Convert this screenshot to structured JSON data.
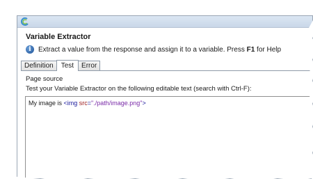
{
  "dialog": {
    "title": "Variable Extractor",
    "description_prefix": "Extract a value from the response and assign it to a variable. Press ",
    "description_key": "F1",
    "description_suffix": " for Help"
  },
  "tabs": [
    {
      "label": "Definition",
      "active": false
    },
    {
      "label": "Test",
      "active": true
    },
    {
      "label": "Error",
      "active": false
    }
  ],
  "panel": {
    "section_label": "Page source",
    "instructions": "Test your Variable Extractor on the following editable text (search with Ctrl-F):",
    "editor": {
      "text_before": "My image is ",
      "tag_open": "<img ",
      "attr_name": "src",
      "attr_eq": "=",
      "attr_value": "\"./path/image.png\"",
      "tag_close": ">"
    }
  },
  "colors": {
    "titlebar": "#c9d7e8",
    "tag": "#1a1a9c",
    "attr": "#9c1a1a",
    "string": "#7a2ba8"
  },
  "icons": {
    "app": "app-logo-icon",
    "info": "info-icon"
  }
}
